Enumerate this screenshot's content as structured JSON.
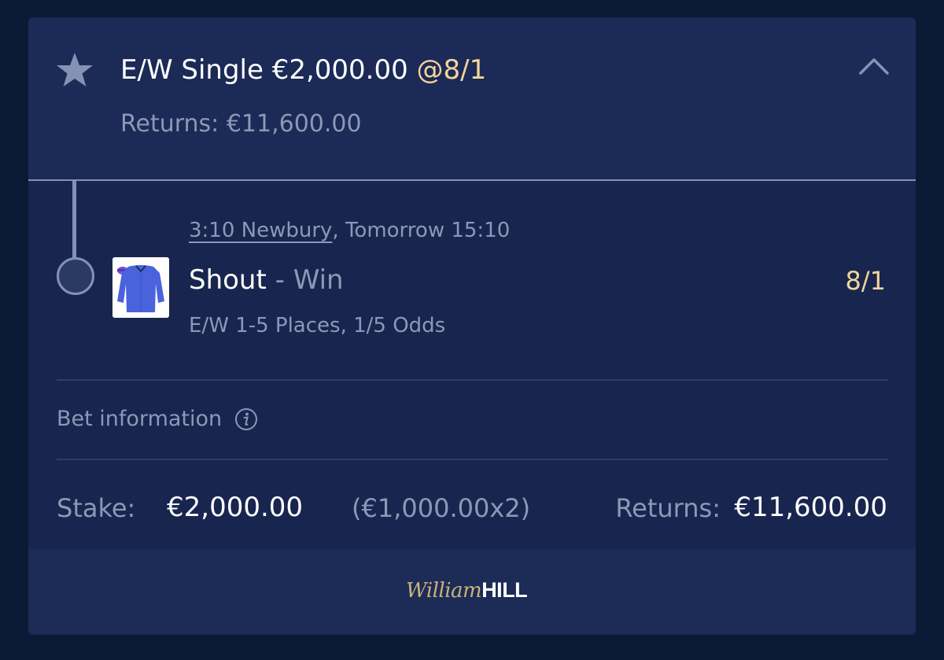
{
  "bet": {
    "title": "E/W Single €2,000.00",
    "title_odds": "@8/1",
    "returns": "Returns: €11,600.00"
  },
  "leg": {
    "event_link": "3:10 Newbury",
    "event_time": ", Tomorrow 15:10",
    "selection": "Shout",
    "separator": " - ",
    "market": "Win",
    "odds": "8/1",
    "ew_terms": "E/W 1-5 Places, 1/5 Odds"
  },
  "bet_information": {
    "label": "Bet information"
  },
  "summary": {
    "stake_label": "Stake:",
    "stake_value": "€2,000.00",
    "stake_split": "(€1,000.00x2)",
    "returns_label": "Returns:",
    "returns_value": "€11,600.00"
  },
  "branding": {
    "script": "William",
    "bold": "HILL"
  },
  "icons": {
    "favourite": "star-icon",
    "collapse": "chevron-up-icon",
    "info": "info-icon",
    "silks": "jockey-silks-icon"
  },
  "colors": {
    "background": "#0c1935",
    "card": "#18264f",
    "odds_gold": "#f2d49b",
    "muted_text": "#8d98b7",
    "silks_blue": "#4a63dc"
  }
}
